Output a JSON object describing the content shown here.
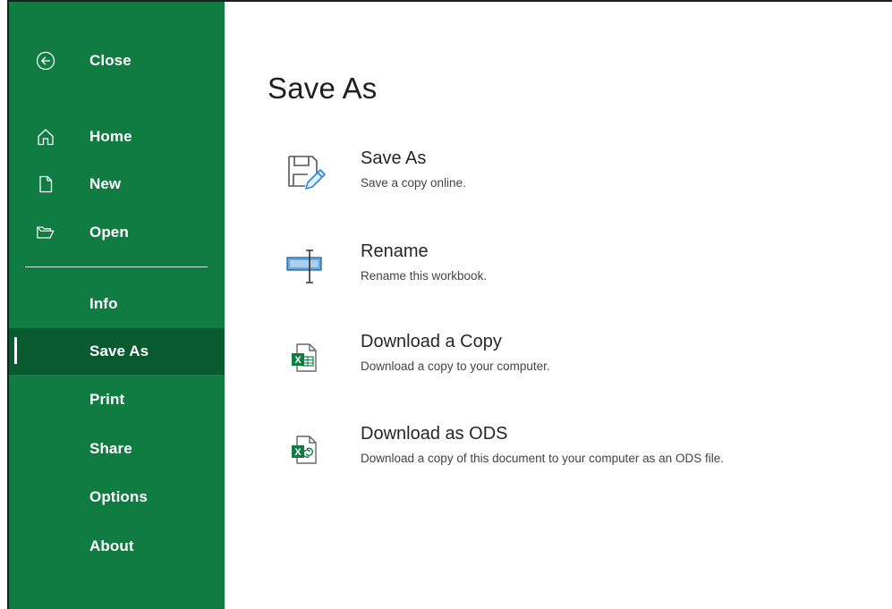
{
  "sidebar": {
    "close_label": "Close",
    "home_label": "Home",
    "new_label": "New",
    "open_label": "Open",
    "info_label": "Info",
    "save_as_label": "Save As",
    "print_label": "Print",
    "share_label": "Share",
    "options_label": "Options",
    "about_label": "About",
    "selected_item": "Save As"
  },
  "main": {
    "title": "Save As",
    "options": [
      {
        "title": "Save As",
        "description": "Save a copy online.",
        "icon": "save-as-icon"
      },
      {
        "title": "Rename",
        "description": "Rename this workbook.",
        "icon": "rename-icon"
      },
      {
        "title": "Download a Copy",
        "description": "Download a copy to your computer.",
        "icon": "excel-file-icon"
      },
      {
        "title": "Download as ODS",
        "description": "Download a copy of this document to your computer as an ODS file.",
        "icon": "ods-file-icon"
      }
    ]
  },
  "colors": {
    "sidebar_bg": "#107c41",
    "sidebar_selected_bg": "#0a5a2f",
    "excel_green": "#107c41",
    "accent_blue": "#2b88d8"
  }
}
